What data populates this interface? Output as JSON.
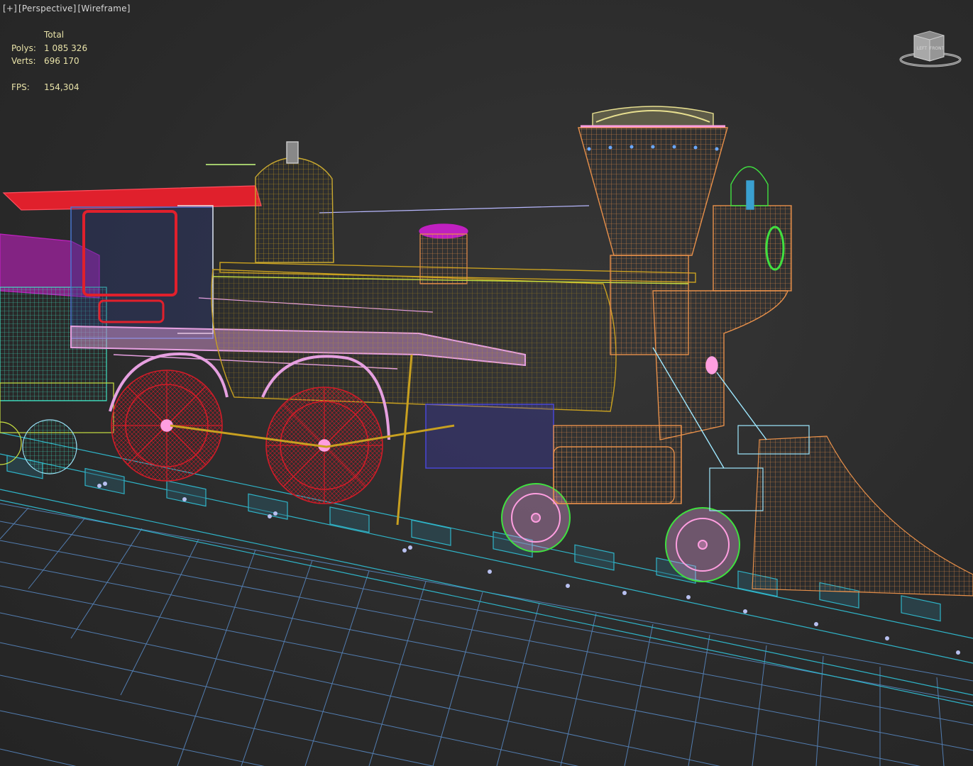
{
  "viewport": {
    "label": {
      "plus": "[+]",
      "view": "[Perspective]",
      "shading": "[Wireframe]"
    },
    "stats": {
      "header": "Total",
      "polys_label": "Polys:",
      "polys_value": "1 085 326",
      "verts_label": "Verts:",
      "verts_value": "696 170",
      "fps_label": "FPS:",
      "fps_value": "154,304"
    },
    "viewcube": {
      "face_left": "LEFT",
      "face_front": "FRONT"
    }
  },
  "scene": {
    "subject": "steam-locomotive-wireframe",
    "colors": {
      "grid": "#5a8cc8",
      "track": "#2fb4c8",
      "cab_roof": "#e0202c",
      "cab": "#4a7ad8",
      "frame": "#e6a0e0",
      "drive_wheels": "#d01c28",
      "boiler": "#c8a020",
      "smokestack": "#e8904a",
      "stack_cap": "#e8e090",
      "front_truck_wheels": "#40e040",
      "cowcatcher": "#e8904a",
      "headlamp": "#e8904a",
      "tender": "#40e0c0",
      "magenta": "#c020c0",
      "bell_dome": "#c8a830"
    }
  }
}
